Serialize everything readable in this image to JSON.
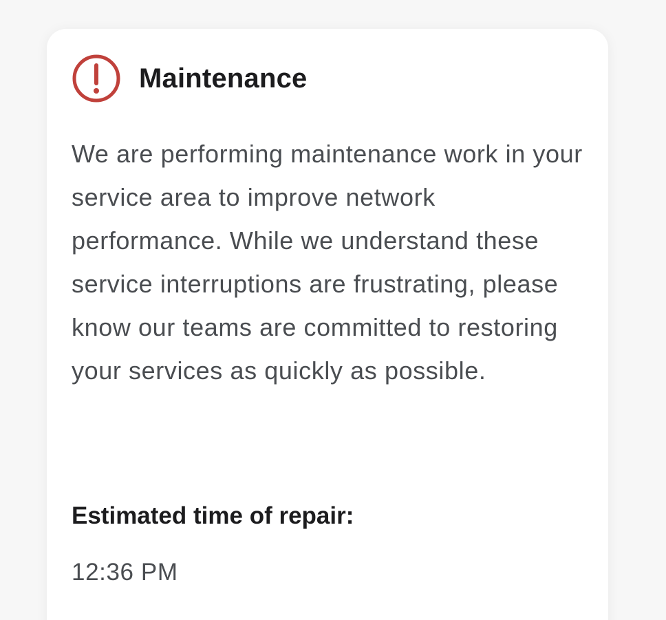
{
  "colors": {
    "alert_accent": "#c0413b",
    "title_text": "#1c1c1e",
    "body_text": "#4a4d51",
    "card_background": "#ffffff",
    "page_background": "#f7f7f7"
  },
  "alert": {
    "icon": "exclamation-circle-icon",
    "title": "Maintenance",
    "message": "We are performing maintenance work in your service area to improve network performance. While we understand these service interruptions are frustrating, please know our teams are committed to restoring your services as quickly as possible.",
    "repair_label": "Estimated time of repair:",
    "repair_time": "12:36 PM"
  }
}
